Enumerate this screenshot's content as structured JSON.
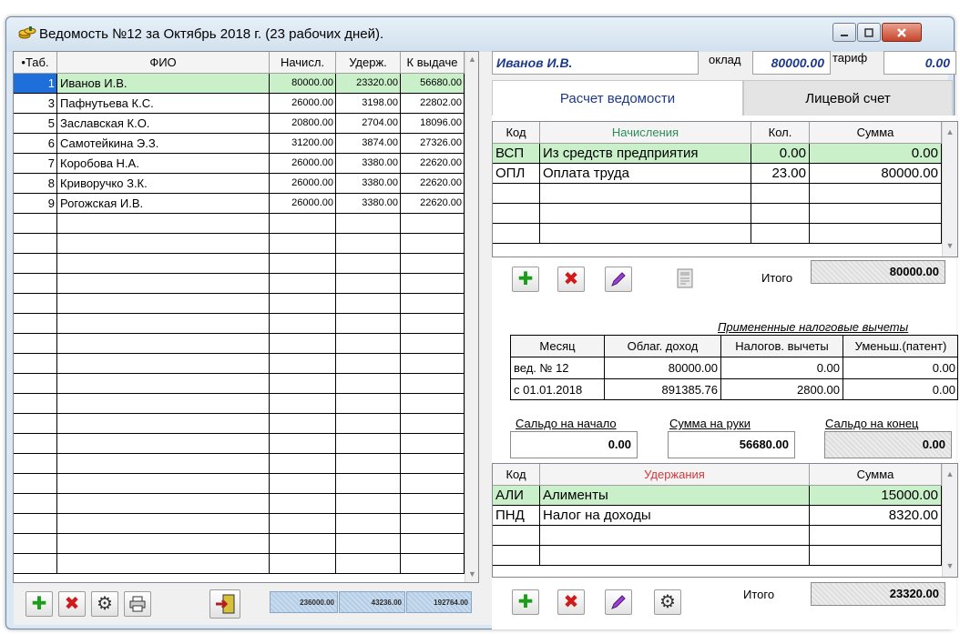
{
  "window": {
    "title": "Ведомость №12 за Октябрь 2018 г. (23 рабочих дней)."
  },
  "left_grid": {
    "headers": [
      "•Таб.",
      "ФИО",
      "Начисл.",
      "Удерж.",
      "К выдаче"
    ],
    "rows": [
      {
        "tab": "1",
        "fio": "Иванов И.В.",
        "nach": "80000.00",
        "uderzh": "23320.00",
        "k_vydache": "56680.00"
      },
      {
        "tab": "3",
        "fio": "Пафнутьева К.С.",
        "nach": "26000.00",
        "uderzh": "3198.00",
        "k_vydache": "22802.00"
      },
      {
        "tab": "5",
        "fio": "Заславская К.О.",
        "nach": "20800.00",
        "uderzh": "2704.00",
        "k_vydache": "18096.00"
      },
      {
        "tab": "6",
        "fio": "Самотейкина Э.З.",
        "nach": "31200.00",
        "uderzh": "3874.00",
        "k_vydache": "27326.00"
      },
      {
        "tab": "7",
        "fio": "Коробова Н.А.",
        "nach": "26000.00",
        "uderzh": "3380.00",
        "k_vydache": "22620.00"
      },
      {
        "tab": "8",
        "fio": "Криворучко З.К.",
        "nach": "26000.00",
        "uderzh": "3380.00",
        "k_vydache": "22620.00"
      },
      {
        "tab": "9",
        "fio": "Рогожская И.В.",
        "nach": "26000.00",
        "uderzh": "3380.00",
        "k_vydache": "22620.00"
      }
    ],
    "totals": {
      "nach": "236000.00",
      "uderzh": "43236.00",
      "k_vydache": "192764.00"
    }
  },
  "employee": {
    "name": "Иванов И.В.",
    "oklad_label": "оклад",
    "oklad": "80000.00",
    "tarif_label": "тариф",
    "tarif": "0.00"
  },
  "tabs": {
    "active": "Расчет ведомости",
    "inactive": "Лицевой счет"
  },
  "accruals": {
    "headers": [
      "Код",
      "Начисления",
      "Кол.",
      "Сумма"
    ],
    "rows": [
      {
        "kod": "ВСП",
        "name": "Из средств предприятия",
        "kol": "0.00",
        "summa": "0.00"
      },
      {
        "kod": "ОПЛ",
        "name": "Оплата труда",
        "kol": "23.00",
        "summa": "80000.00"
      }
    ],
    "itogo_label": "Итого",
    "itogo": "80000.00"
  },
  "tax_deductions": {
    "title": "Примененные налоговые вычеты",
    "headers": [
      "Месяц",
      "Облаг. доход",
      "Налогов. вычеты",
      "Уменьш.(патент)"
    ],
    "rows": [
      {
        "mesyac": "вед. № 12",
        "dohod": "80000.00",
        "vychety": "0.00",
        "patent": "0.00"
      },
      {
        "mesyac": "с 01.01.2018",
        "dohod": "891385.76",
        "vychety": "2800.00",
        "patent": "0.00"
      }
    ]
  },
  "saldo": {
    "start_label": "Сальдо на начало",
    "start": "0.00",
    "hands_label": "Сумма на руки",
    "hands": "56680.00",
    "end_label": "Сальдо на конец",
    "end": "0.00"
  },
  "deductions": {
    "headers": [
      "Код",
      "Удержания",
      "Сумма"
    ],
    "rows": [
      {
        "kod": "АЛИ",
        "name": "Алименты",
        "summa": "15000.00"
      },
      {
        "kod": "ПНД",
        "name": "Налог на доходы",
        "summa": "8320.00"
      }
    ],
    "itogo_label": "Итого",
    "itogo": "23320.00"
  },
  "colors": {
    "selected_row": "#c9f0c9",
    "accent_blue": "#1e3a8a",
    "header_green": "#2e8b57",
    "header_red": "#d23a3a"
  }
}
